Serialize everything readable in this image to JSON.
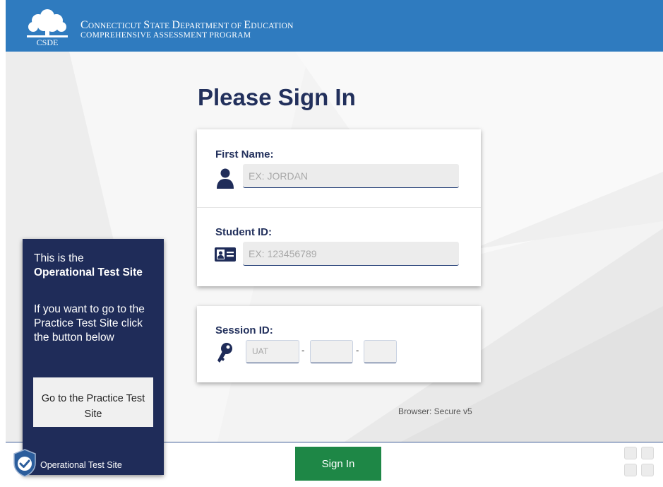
{
  "header": {
    "title_parts": [
      {
        "big": "C",
        "small": "ONNECTICUT "
      },
      {
        "big": "S",
        "small": "TATE "
      },
      {
        "big": "D",
        "small": "EPARTMENT OF "
      },
      {
        "big": "E",
        "small": "DUCATION"
      }
    ],
    "subtitle": "COMPREHENSIVE ASSESSMENT PROGRAM",
    "logo_text": "CSDE",
    "brand_color": "#2f7bbf"
  },
  "page_title": "Please Sign In",
  "form": {
    "first_name": {
      "label": "First Name:",
      "placeholder": "EX: JORDAN",
      "icon": "person-icon"
    },
    "student_id": {
      "label": "Student ID:",
      "placeholder": "EX: 123456789",
      "icon": "id-card-icon"
    },
    "session_id": {
      "label": "Session ID:",
      "prefix_value": "UAT",
      "separator": "-",
      "icon": "key-icon"
    }
  },
  "browser_info": "Browser: Secure v5",
  "side_panel": {
    "line1": "This is the",
    "line2": "Operational Test Site",
    "line3": "If you want to go to the Practice Test Site click the button below",
    "button_label": "Go to the Practice Test Site"
  },
  "footer": {
    "site_label": "Operational Test Site",
    "signin_label": "Sign In",
    "signin_color": "#1e8746"
  }
}
